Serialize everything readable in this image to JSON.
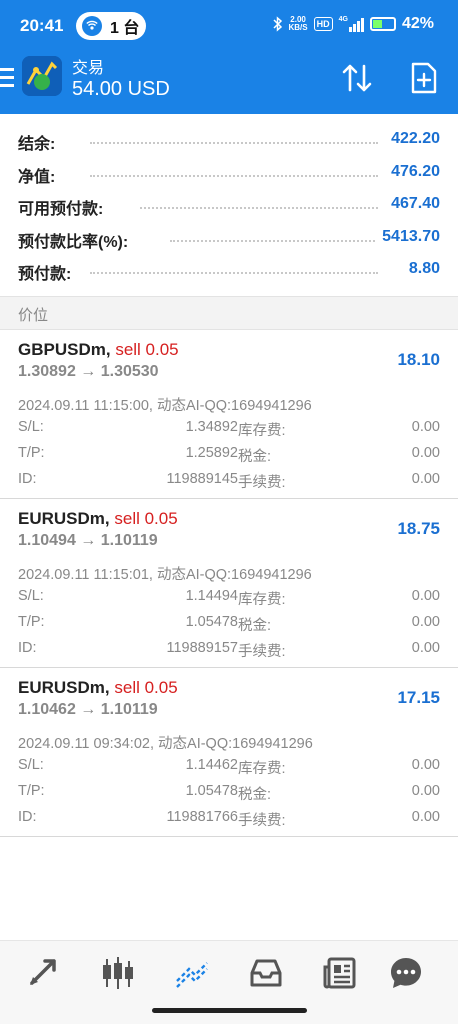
{
  "status_bar": {
    "time": "20:41",
    "pill_text": "1 台",
    "speed_top": "2.00",
    "speed_bottom": "KB/S",
    "hd": "HD",
    "network": "4G",
    "battery": "42%"
  },
  "header": {
    "title": "交易",
    "balance": "54.00 USD"
  },
  "summary": [
    {
      "label": "结余:",
      "value": "422.20"
    },
    {
      "label": "净值:",
      "value": "476.20"
    },
    {
      "label": "可用预付款:",
      "value": "467.40"
    },
    {
      "label": "预付款比率(%):",
      "value": "5413.70"
    },
    {
      "label": "预付款:",
      "value": "8.80"
    }
  ],
  "section_title": "价位",
  "positions": [
    {
      "symbol": "GBPUSDm,",
      "side": "sell 0.05",
      "prices": "1.30892 → 1.30530",
      "profit": "18.10",
      "meta": "2024.09.11 11:15:00, 动态AI-QQ:1694941296",
      "sl_label": "S/L:",
      "sl": "1.34892",
      "tp_label": "T/P:",
      "tp": "1.25892",
      "id_label": "ID:",
      "id": "119889145",
      "swap_label": "库存费:",
      "swap": "0.00",
      "tax_label": "税金:",
      "tax": "0.00",
      "fee_label": "手续费:",
      "fee": "0.00"
    },
    {
      "symbol": "EURUSDm,",
      "side": "sell 0.05",
      "prices": "1.10494 → 1.10119",
      "profit": "18.75",
      "meta": "2024.09.11 11:15:01, 动态AI-QQ:1694941296",
      "sl_label": "S/L:",
      "sl": "1.14494",
      "tp_label": "T/P:",
      "tp": "1.05478",
      "id_label": "ID:",
      "id": "119889157",
      "swap_label": "库存费:",
      "swap": "0.00",
      "tax_label": "税金:",
      "tax": "0.00",
      "fee_label": "手续费:",
      "fee": "0.00"
    },
    {
      "symbol": "EURUSDm,",
      "side": "sell 0.05",
      "prices": "1.10462 → 1.10119",
      "profit": "17.15",
      "meta": "2024.09.11 09:34:02, 动态AI-QQ:1694941296",
      "sl_label": "S/L:",
      "sl": "1.14462",
      "tp_label": "T/P:",
      "tp": "1.05478",
      "id_label": "ID:",
      "id": "119881766",
      "swap_label": "库存费:",
      "swap": "0.00",
      "tax_label": "税金:",
      "tax": "0.00",
      "fee_label": "手续费:",
      "fee": "0.00"
    }
  ],
  "nav": {
    "items": [
      "quotes-icon",
      "chart-icon",
      "trade-icon",
      "history-icon",
      "news-icon",
      "messages-icon"
    ],
    "active": "trade-icon"
  },
  "colors": {
    "accent": "#1a82e6",
    "profit_blue": "#1a6fd1",
    "sell_red": "#d62020"
  }
}
